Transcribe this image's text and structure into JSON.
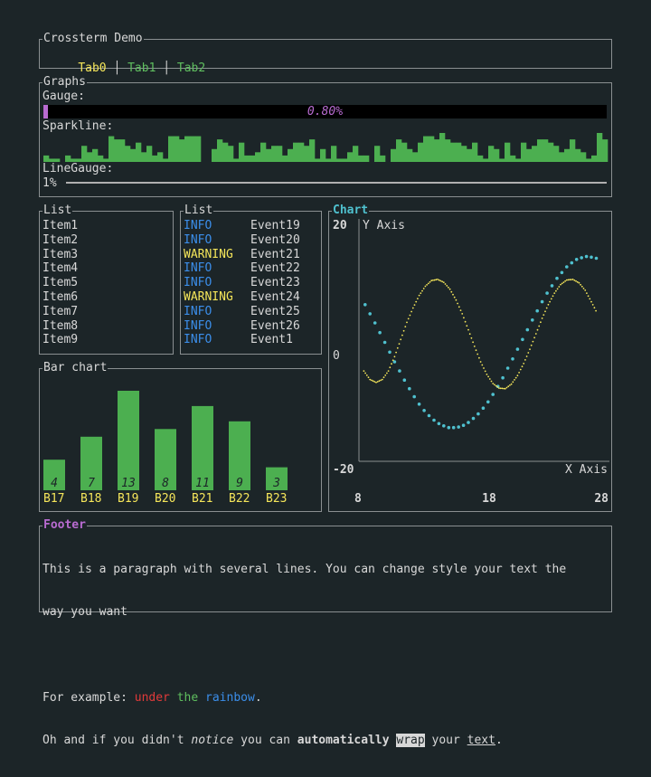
{
  "app": {
    "title": "Crossterm Demo"
  },
  "tabs": [
    {
      "label": "Tab0",
      "color": "#f5e65a"
    },
    {
      "label": "Tab1",
      "color": "#5fbf5f"
    },
    {
      "label": "Tab2",
      "color": "#5fbf5f"
    }
  ],
  "graphs": {
    "title": "Graphs",
    "gauge": {
      "label": "Gauge:",
      "value_text": "0.80%",
      "fraction": 0.008,
      "color": "#b86bd1"
    },
    "sparkline": {
      "label": "Sparkline:",
      "color": "#4caf50",
      "values": [
        2,
        1,
        1,
        0,
        2,
        1,
        1,
        5,
        3,
        4,
        2,
        1,
        8,
        7,
        7,
        5,
        4,
        6,
        3,
        5,
        2,
        3,
        1,
        8,
        8,
        7,
        8,
        8,
        8,
        0,
        0,
        4,
        7,
        6,
        5,
        1,
        6,
        2,
        2,
        3,
        6,
        4,
        5,
        5,
        2,
        4,
        6,
        6,
        5,
        7,
        1,
        4,
        1,
        5,
        1,
        1,
        3,
        5,
        2,
        2,
        0,
        5,
        2,
        0,
        4,
        7,
        6,
        4,
        3,
        6,
        8,
        8,
        7,
        9,
        7,
        6,
        6,
        5,
        4,
        6,
        2,
        1,
        5,
        4,
        1,
        6,
        2,
        1,
        6,
        4,
        5,
        7,
        7,
        6,
        5,
        3,
        4,
        7,
        4,
        3,
        1,
        2,
        9,
        7
      ]
    },
    "linegauge": {
      "label": "LineGauge:",
      "value_text": "1%",
      "fraction": 0.01
    }
  },
  "list_items": {
    "title": "List",
    "items": [
      "Item1",
      "Item2",
      "Item3",
      "Item4",
      "Item5",
      "Item6",
      "Item7",
      "Item8",
      "Item9"
    ]
  },
  "list_logs": {
    "title": "List",
    "rows": [
      {
        "level": "INFO",
        "event": "Event19"
      },
      {
        "level": "INFO",
        "event": "Event20"
      },
      {
        "level": "WARNING",
        "event": "Event21"
      },
      {
        "level": "INFO",
        "event": "Event22"
      },
      {
        "level": "INFO",
        "event": "Event23"
      },
      {
        "level": "WARNING",
        "event": "Event24"
      },
      {
        "level": "INFO",
        "event": "Event25"
      },
      {
        "level": "INFO",
        "event": "Event26"
      },
      {
        "level": "INFO",
        "event": "Event1"
      }
    ],
    "colors": {
      "INFO": "#3b8eea",
      "WARNING": "#f5e65a"
    }
  },
  "barchart": {
    "title": "Bar chart",
    "bar_color": "#4caf50",
    "label_color": "#f5e65a"
  },
  "chart": {
    "title": "Chart",
    "x_axis_title": "X Axis",
    "y_axis_title": "Y Axis"
  },
  "chart_data": [
    {
      "type": "bar",
      "categories": [
        "B17",
        "B18",
        "B19",
        "B20",
        "B21",
        "B22",
        "B23"
      ],
      "values": [
        4,
        7,
        13,
        8,
        11,
        9,
        3
      ],
      "ylim": [
        0,
        13
      ]
    },
    {
      "type": "scatter",
      "title": "Chart",
      "xlabel": "X Axis",
      "ylabel": "Y Axis",
      "xlim": [
        8,
        28
      ],
      "ylim": [
        -20,
        20
      ],
      "x_ticks": [
        "8",
        "18",
        "28"
      ],
      "y_ticks": [
        "20",
        "0",
        "-20"
      ],
      "grid": false,
      "series": [
        {
          "color": "#4fc1cf",
          "x": [
            8.5,
            8.9,
            9.3,
            9.7,
            10.1,
            10.5,
            10.9,
            11.3,
            11.7,
            12.1,
            12.5,
            12.9,
            13.3,
            13.7,
            14.1,
            14.5,
            14.9,
            15.3,
            15.7,
            16.1,
            16.5,
            16.9,
            17.3,
            17.7,
            18.1,
            18.5,
            18.9,
            19.3,
            19.7,
            20.1,
            20.5,
            20.9,
            21.3,
            21.7,
            22.1,
            22.5,
            22.9,
            23.3,
            23.7,
            24.1,
            24.5,
            24.9,
            25.3,
            25.7,
            26.1,
            26.5,
            26.9,
            27.3
          ],
          "y": [
            6.6,
            5,
            3.4,
            1.7,
            0,
            -1.7,
            -3.4,
            -5,
            -6.6,
            -8.1,
            -9.5,
            -10.8,
            -11.9,
            -12.8,
            -13.6,
            -14.2,
            -14.6,
            -14.9,
            -14.9,
            -14.8,
            -14.5,
            -14,
            -13.3,
            -12.5,
            -11.5,
            -10.4,
            -9.1,
            -7.7,
            -6.2,
            -4.5,
            -2.9,
            -1.2,
            0.5,
            2.2,
            3.9,
            5.5,
            7.1,
            8.6,
            9.9,
            11.2,
            12.2,
            13.2,
            13.9,
            14.5,
            14.8,
            15,
            14.9,
            14.7
          ]
        },
        {
          "color": "#f5e65a",
          "x": [
            8.4,
            8.9,
            9.4,
            9.9,
            10.4,
            10.9,
            11.4,
            11.9,
            12.4,
            12.9,
            13.4,
            13.9,
            14.4,
            14.9,
            15.4,
            15.9,
            16.4,
            16.9,
            17.4,
            17.9,
            18.4,
            18.9,
            19.4,
            19.9,
            20.4,
            20.9,
            21.4,
            21.9,
            22.4,
            22.9,
            23.4,
            23.9,
            24.4,
            24.9,
            25.4,
            25.9,
            26.4,
            26.9,
            27.4
          ],
          "y": [
            -5,
            -6.5,
            -7,
            -6.5,
            -5,
            -2.5,
            0.5,
            3.5,
            6,
            8.2,
            9.8,
            10.8,
            11,
            10.5,
            9.3,
            7.4,
            5,
            2.2,
            -0.7,
            -3.4,
            -5.6,
            -7.2,
            -8,
            -8.1,
            -7.3,
            -5.8,
            -3.7,
            -1.2,
            1.5,
            4.2,
            6.6,
            8.6,
            10.1,
            10.9,
            11,
            10.4,
            9.1,
            7.1,
            5
          ]
        }
      ]
    }
  ],
  "footer": {
    "title": "Footer",
    "line1": "This is a paragraph with several lines. You can change style your text the",
    "line2": "way you want",
    "ex_prefix": "For example: ",
    "ex_under": "under",
    "ex_the": "the",
    "ex_rainbow": "rainbow",
    "ex_dot": ".",
    "l4_a": "Oh and if you didn't ",
    "l4_notice": "notice",
    "l4_b": " you can ",
    "l4_auto": "automatically",
    "l4_c": " ",
    "l4_wrap": "wrap",
    "l4_d": " your ",
    "l4_text": "text",
    "l4_e": "."
  }
}
